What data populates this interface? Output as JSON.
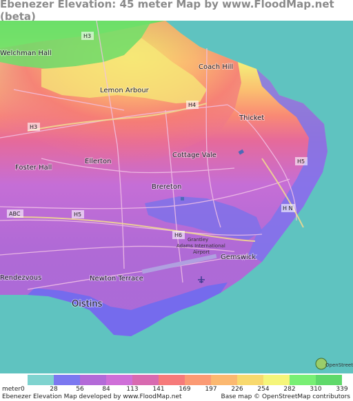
{
  "title": "Ebenezer Elevation: 45 meter Map by www.FloodMap.net (beta)",
  "map": {
    "places": [
      {
        "id": "welchman-hall",
        "label": "Welchman Hall"
      },
      {
        "id": "coach-hill",
        "label": "Coach Hill"
      },
      {
        "id": "lemon-arbour",
        "label": "Lemon Arbour"
      },
      {
        "id": "thicket",
        "label": "Thicket"
      },
      {
        "id": "foster-hall",
        "label": "Foster Hall"
      },
      {
        "id": "ellerton",
        "label": "Ellerton"
      },
      {
        "id": "cottage-vale",
        "label": "Cottage Vale"
      },
      {
        "id": "brereton",
        "label": "Brereton"
      },
      {
        "id": "gemswick",
        "label": "Gemswick"
      },
      {
        "id": "rendezvous",
        "label": "Rendezvous"
      },
      {
        "id": "newton-terrace",
        "label": "Newton Terrace"
      },
      {
        "id": "oistins",
        "label": "Oistins"
      }
    ],
    "roads": [
      {
        "id": "h3-top",
        "label": "H3"
      },
      {
        "id": "h4",
        "label": "H4"
      },
      {
        "id": "h3-left",
        "label": "H3"
      },
      {
        "id": "h5-right",
        "label": "H5"
      },
      {
        "id": "hn",
        "label": "H N"
      },
      {
        "id": "abc",
        "label": "ABC"
      },
      {
        "id": "h5-left",
        "label": "H5"
      },
      {
        "id": "h6",
        "label": "H6"
      }
    ],
    "airport_label_1": "Grantley",
    "airport_label_2": "Adams International",
    "airport_label_3": "Airport",
    "osm_logo": "OpenStreetMap",
    "colors": {
      "sea": "#5fc3c0",
      "low": "#6f6cf0",
      "mid": "#c06ad0",
      "high": "#f07070",
      "top": "#66dd66"
    }
  },
  "legend": {
    "unit": "meter",
    "ticks": [
      "0",
      "28",
      "56",
      "84",
      "113",
      "141",
      "169",
      "197",
      "226",
      "254",
      "282",
      "310",
      "339"
    ],
    "colors": [
      "#7fd3cf",
      "#7b78f0",
      "#b36ad8",
      "#cf6fd8",
      "#d86ab0",
      "#f67a7a",
      "#fb9a74",
      "#fbb870",
      "#f8d96e",
      "#f5f57a",
      "#78ef74",
      "#5fd96a"
    ],
    "credit_left": "Ebenezer Elevation Map developed by www.FloodMap.net",
    "credit_right": "Base map © OpenStreetMap contributors"
  }
}
